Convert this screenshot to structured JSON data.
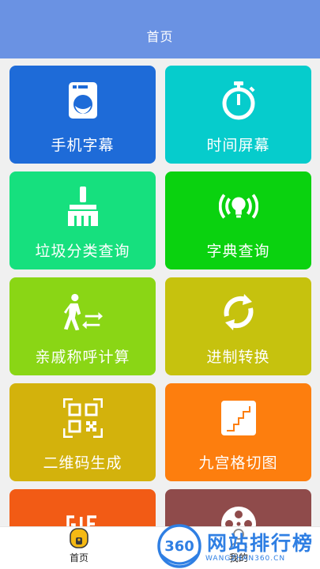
{
  "header": {
    "title": "首页"
  },
  "tiles": [
    {
      "label": "手机字幕",
      "icon": "washing-machine-icon",
      "color": "#1e6bd8"
    },
    {
      "label": "时间屏幕",
      "icon": "stopwatch-icon",
      "color": "#06cccc"
    },
    {
      "label": "垃圾分类查询",
      "icon": "broom-icon",
      "color": "#16e07e"
    },
    {
      "label": "字典查询",
      "icon": "bulb-signal-icon",
      "color": "#0ad20f"
    },
    {
      "label": "亲戚称呼计算",
      "icon": "person-exchange-icon",
      "color": "#8ad615"
    },
    {
      "label": "进制转换",
      "icon": "refresh-icon",
      "color": "#c6c20e"
    },
    {
      "label": "二维码生成",
      "icon": "qr-code-icon",
      "color": "#d3b20c"
    },
    {
      "label": "九宫格切图",
      "icon": "stairs-icon",
      "color": "#fd7e0e"
    },
    {
      "label": "",
      "icon": "gif-icon",
      "color": "#f25b15"
    },
    {
      "label": "",
      "icon": "film-reel-icon",
      "color": "#8f4b4b"
    }
  ],
  "tabbar": {
    "items": [
      {
        "label": "首页",
        "icon": "home-icon"
      },
      {
        "label": "我的",
        "icon": "user-icon"
      }
    ]
  },
  "watermark": {
    "badge": "360",
    "text": "网站排行榜",
    "sub": "WANGZHAN360.CN"
  }
}
